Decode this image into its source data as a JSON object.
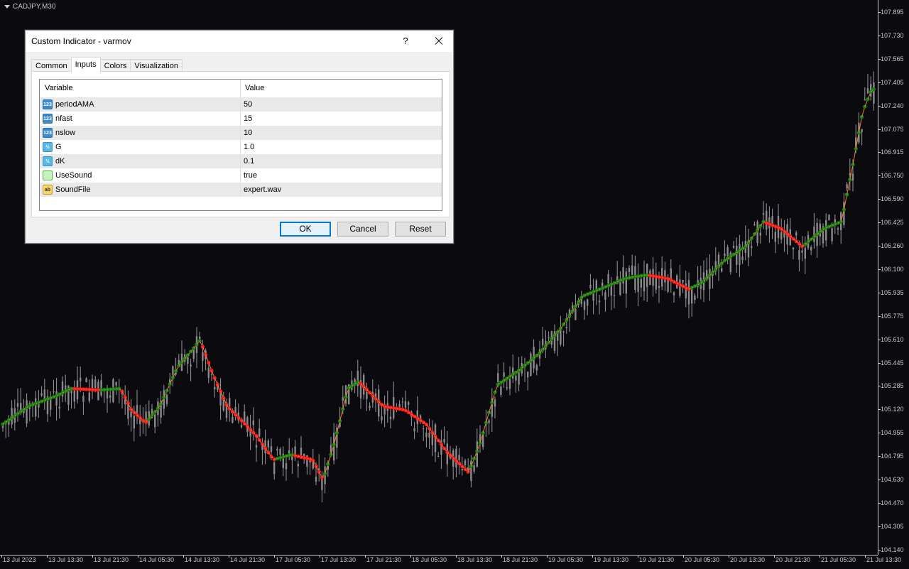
{
  "chart": {
    "symbol": "CADJPY,M30",
    "background": "#0b0b0f",
    "candle_color": "#c8c8c8",
    "ama_up_color": "#0f8a0f",
    "ama_down_color": "#ff1a1a",
    "price_labels": [
      "107.895",
      "107.730",
      "107.565",
      "107.405",
      "107.240",
      "107.075",
      "106.915",
      "106.750",
      "106.590",
      "106.425",
      "106.260",
      "106.100",
      "105.935",
      "105.775",
      "105.610",
      "105.445",
      "105.285",
      "105.120",
      "104.955",
      "104.795",
      "104.630",
      "104.470",
      "104.305",
      "104.140"
    ],
    "time_labels": [
      "13 Jul 2023",
      "13 Jul 13:30",
      "13 Jul 21:30",
      "14 Jul 05:30",
      "14 Jul 13:30",
      "14 Jul 21:30",
      "17 Jul 05:30",
      "17 Jul 13:30",
      "17 Jul 21:30",
      "18 Jul 05:30",
      "18 Jul 13:30",
      "18 Jul 21:30",
      "19 Jul 05:30",
      "19 Jul 13:30",
      "19 Jul 21:30",
      "20 Jul 05:30",
      "20 Jul 13:30",
      "20 Jul 21:30",
      "21 Jul 05:30",
      "21 Jul 13:30"
    ]
  },
  "dialog": {
    "title": "Custom Indicator - varmov",
    "help": "?",
    "tabs": [
      "Common",
      "Inputs",
      "Colors",
      "Visualization"
    ],
    "active_tab": "Inputs",
    "columns": [
      "Variable",
      "Value"
    ],
    "inputs": [
      {
        "icon": "int-icon",
        "icon_text": "123",
        "name": "periodAMA",
        "value": "50"
      },
      {
        "icon": "int-icon",
        "icon_text": "123",
        "name": "nfast",
        "value": "15"
      },
      {
        "icon": "int-icon",
        "icon_text": "123",
        "name": "nslow",
        "value": "10"
      },
      {
        "icon": "double-icon",
        "icon_text": "½",
        "name": "G",
        "value": "1.0"
      },
      {
        "icon": "double-icon",
        "icon_text": "½",
        "name": "dK",
        "value": "0.1"
      },
      {
        "icon": "bool-icon",
        "icon_text": "",
        "name": "UseSound",
        "value": "true"
      },
      {
        "icon": "string-icon",
        "icon_text": "ab",
        "name": "SoundFile",
        "value": "expert.wav"
      }
    ],
    "buttons": {
      "ok": "OK",
      "cancel": "Cancel",
      "reset": "Reset"
    }
  }
}
